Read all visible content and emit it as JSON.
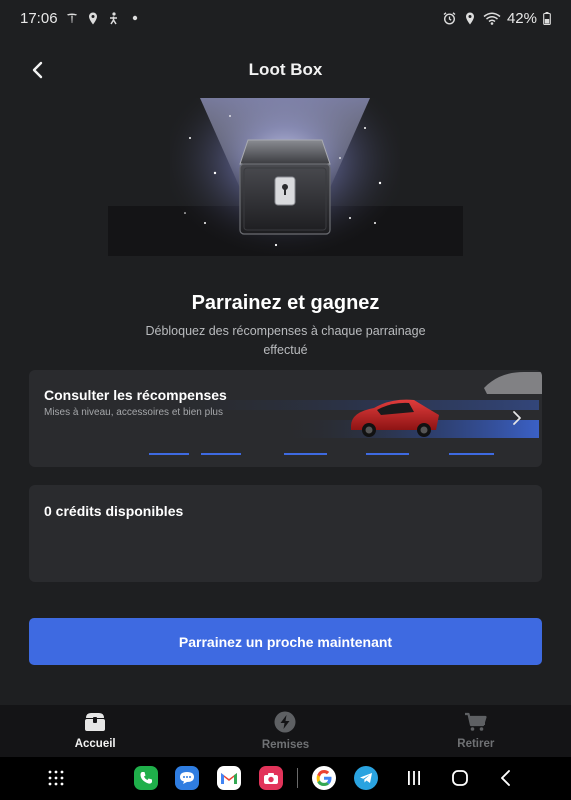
{
  "status_bar": {
    "time": "17:06",
    "battery": "42%",
    "icons_left": [
      "tesla-icon",
      "location-icon",
      "accessibility-icon",
      "dot-icon"
    ],
    "icons_right": [
      "alarm-icon",
      "location-icon",
      "wifi-icon",
      "battery-icon"
    ]
  },
  "header": {
    "title": "Loot Box",
    "back_icon": "chevron-left-icon"
  },
  "hero": {
    "image": "loot-box-chest-icon"
  },
  "intro": {
    "heading": "Parrainez et gagnez",
    "subtitle": "Débloquez des récompenses à chaque parrainage effectué"
  },
  "rewards_card": {
    "title": "Consulter les récompenses",
    "subtitle": "Mises à niveau, accessoires et bien plus",
    "chevron_icon": "chevron-right-icon",
    "image": "red-car-illustration"
  },
  "credits_card": {
    "title": "0 crédits disponibles"
  },
  "cta": {
    "label": "Parrainez un proche maintenant",
    "color": "#3e6ae1"
  },
  "tab_bar": {
    "tabs": [
      {
        "label": "Accueil",
        "icon": "chest-icon",
        "active": true
      },
      {
        "label": "Remises",
        "icon": "bolt-icon",
        "active": false
      },
      {
        "label": "Retirer",
        "icon": "cart-icon",
        "active": false
      }
    ]
  },
  "system_nav": {
    "apps": [
      "app-drawer-icon",
      "phone-icon",
      "messages-icon",
      "gmail-icon",
      "camera-icon",
      "google-icon",
      "telegram-icon"
    ],
    "buttons": [
      "recents-icon",
      "home-icon",
      "back-icon"
    ]
  }
}
